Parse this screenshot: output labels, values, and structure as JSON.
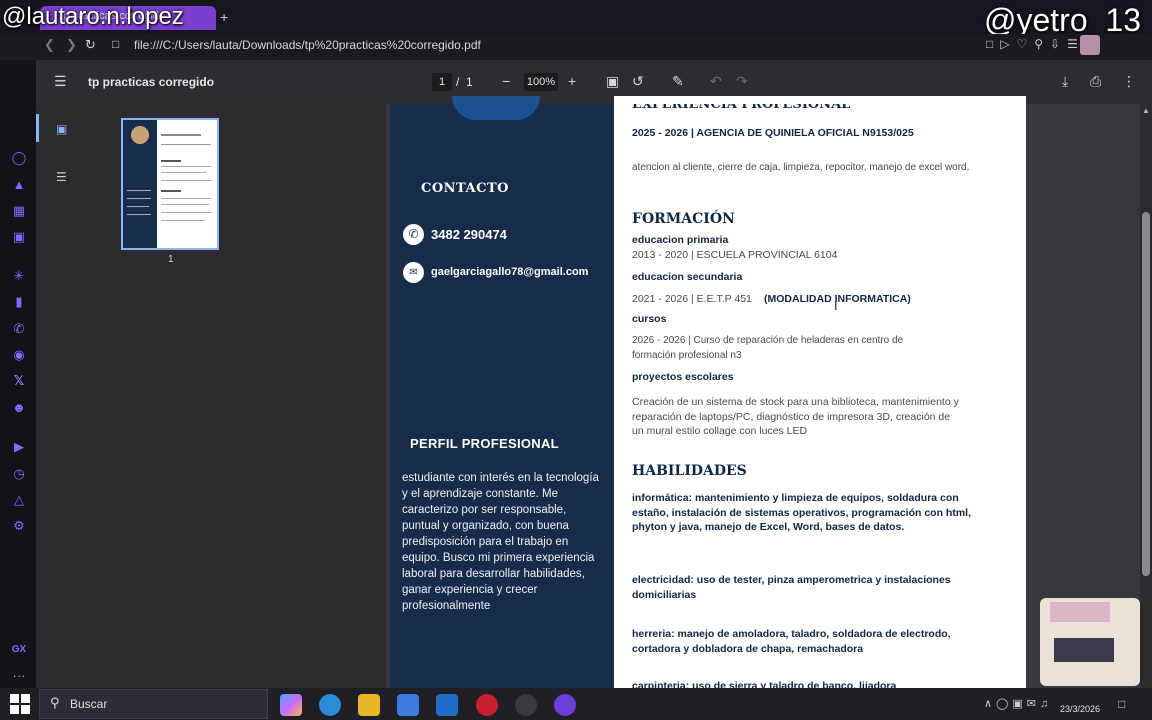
{
  "browser": {
    "tab_title": "tp practicas corregido",
    "new_tab": "+",
    "url": "file:///C:/Users/lauta/Downloads/tp%20practicas%20corregido.pdf"
  },
  "overlays": {
    "top_left": "@lautaro.n.lopez",
    "top_right": "@yetro_13"
  },
  "pdf_toolbar": {
    "title": "tp practicas corregido",
    "page_current": "1",
    "page_sep": "/",
    "page_total": "1",
    "zoom": "100%"
  },
  "thumbnail": {
    "page_number": "1"
  },
  "resume": {
    "left": {
      "contact_title": "CONTACTO",
      "phone": "3482 290474",
      "email": "gaelgarciagallo78@gmail.com",
      "profile_title": "PERFIL PROFESIONAL",
      "profile_text": "estudiante con interés en la tecnología y el aprendizaje constante. Me caracterizo por ser responsable, puntual y organizado, con buena predisposición para el trabajo en equipo. Busco mi primera experiencia laboral para desarrollar habilidades, ganar experiencia y crecer profesionalmente"
    },
    "right": {
      "exp_title_partial": "EXPERIENCIA PROFESIONAL",
      "exp_job": "2025 - 2026 | AGENCIA DE QUINIELA OFICIAL N9153/025",
      "exp_desc": "atencion al cliente, cierre de caja, limpieza, repocitor, manejo de excel word.",
      "formacion_title": "FORMACIÓN",
      "primaria_title": "educacion primaria",
      "primaria_detail": "2013 - 2020 | ESCUELA PROVINCIAL 6104",
      "secundaria_title": "educacion secundaria",
      "secundaria_detail": "2021 - 2026 | E.E.T.P 451",
      "secundaria_bold": "(MODALIDAD INFORMATICA)",
      "cursos_title": "cursos",
      "cursos_detail": "2026 - 2026 | Curso de reparación de heladeras en centro de formación profesional n3",
      "proyectos_title": "proyectos escolares",
      "proyectos_detail": "Creación de un sistema de stock para una biblioteca, mantenimiento y reparación de laptops/PC, diagnóstico de impresora 3D, creación de un mural estilo collage con luces LED",
      "habilidades_title": "HABILIDADES",
      "hab_informatica": "informática: mantenimiento y limpieza de equipos, soldadura con estaño, instalación de sistemas operativos, programación con html, phyton y java, manejo de Excel, Word, bases de datos.",
      "hab_electricidad": "electricidad: uso de tester, pinza amperometrica y instalaciones domiciliarias",
      "hab_herreria": "herreria: manejo de amoladora, taladro, soldadora de electrodo, cortadora y dobladora de chapa, remachadora",
      "hab_carpinteria_partial": "carpinteria: uso de sierra y taladro de banco, lijadora"
    }
  },
  "taskbar": {
    "search": "Buscar",
    "date": "23/3/2026"
  }
}
